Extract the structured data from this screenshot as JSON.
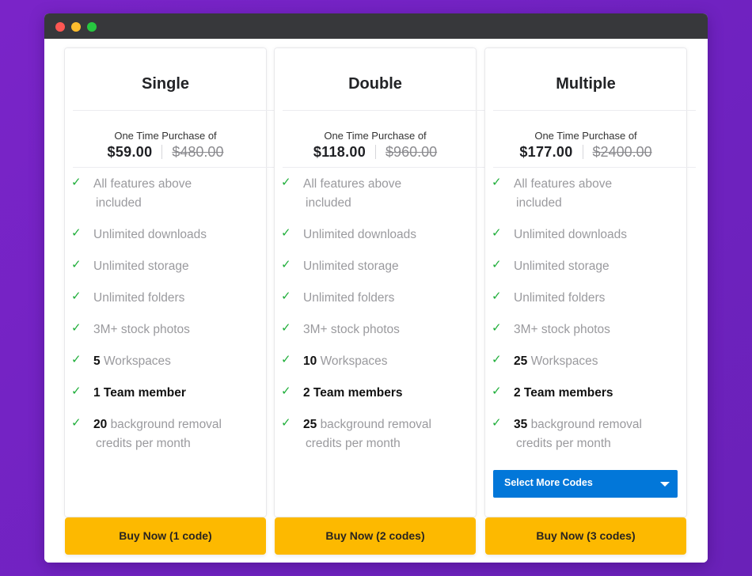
{
  "window": {
    "controls": [
      "close",
      "minimize",
      "maximize"
    ]
  },
  "plans": [
    {
      "title": "Single",
      "purchase_label": "One Time Purchase of",
      "price": "$59.00",
      "old_price": "$480.00",
      "features": [
        {
          "bold": "",
          "text": "All features above",
          "cont": "included"
        },
        {
          "bold": "",
          "text": "Unlimited downloads",
          "cont": ""
        },
        {
          "bold": "",
          "text": "Unlimited storage",
          "cont": ""
        },
        {
          "bold": "",
          "text": "Unlimited folders",
          "cont": ""
        },
        {
          "bold": "",
          "text": "3M+ stock photos",
          "cont": ""
        },
        {
          "bold": "5",
          "text": "Workspaces",
          "cont": ""
        },
        {
          "bold": "1 Team member",
          "text": "",
          "cont": ""
        },
        {
          "bold": "20",
          "text": "background removal",
          "cont": "credits per month"
        }
      ],
      "buy_label": "Buy Now (1 code)"
    },
    {
      "title": "Double",
      "purchase_label": "One Time Purchase of",
      "price": "$118.00",
      "old_price": "$960.00",
      "features": [
        {
          "bold": "",
          "text": "All features above",
          "cont": "included"
        },
        {
          "bold": "",
          "text": "Unlimited downloads",
          "cont": ""
        },
        {
          "bold": "",
          "text": "Unlimited storage",
          "cont": ""
        },
        {
          "bold": "",
          "text": "Unlimited folders",
          "cont": ""
        },
        {
          "bold": "",
          "text": "3M+ stock photos",
          "cont": ""
        },
        {
          "bold": "10",
          "text": "Workspaces",
          "cont": ""
        },
        {
          "bold": "2 Team members",
          "text": "",
          "cont": ""
        },
        {
          "bold": "25",
          "text": "background removal",
          "cont": "credits per month"
        }
      ],
      "buy_label": "Buy Now (2 codes)"
    },
    {
      "title": "Multiple",
      "purchase_label": "One Time Purchase of",
      "price": "$177.00",
      "old_price": "$2400.00",
      "features": [
        {
          "bold": "",
          "text": "All features above",
          "cont": "included"
        },
        {
          "bold": "",
          "text": "Unlimited downloads",
          "cont": ""
        },
        {
          "bold": "",
          "text": "Unlimited storage",
          "cont": ""
        },
        {
          "bold": "",
          "text": "Unlimited folders",
          "cont": ""
        },
        {
          "bold": "",
          "text": "3M+ stock photos",
          "cont": ""
        },
        {
          "bold": "25",
          "text": "Workspaces",
          "cont": ""
        },
        {
          "bold": "2 Team members",
          "text": "",
          "cont": ""
        },
        {
          "bold": "35",
          "text": "background removal",
          "cont": "credits per month"
        }
      ],
      "select_label": "Select More Codes",
      "buy_label": "Buy Now (3 codes)"
    }
  ],
  "icons": {
    "check": "✓"
  },
  "colors": {
    "background": "#7a24c8",
    "titlebar": "#37383b",
    "buy_button": "#fdb900",
    "select_button": "#0277d9",
    "check": "#1fae3a"
  }
}
